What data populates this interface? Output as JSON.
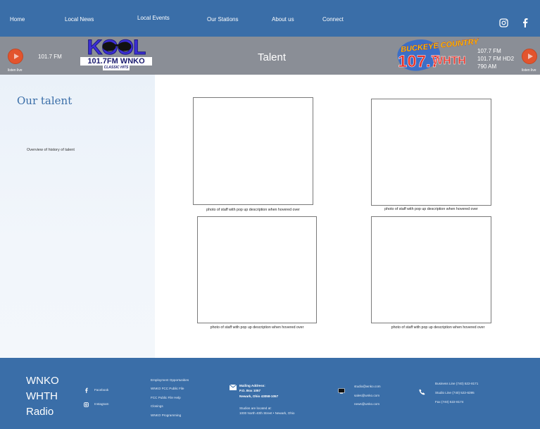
{
  "nav": {
    "links": [
      "Home",
      "Local News",
      "Local Events",
      "Our Stations",
      "About us",
      "Connect"
    ]
  },
  "banner": {
    "left_listen": "listen live",
    "left_freq": "101.7 FM",
    "title": "Talent",
    "right_freqs": [
      "107.7 FM",
      "101.7 FM HD2",
      "790 AM"
    ],
    "right_listen": "listen live",
    "kool_logo": {
      "word": "KOOL",
      "sub": "101.7FM  WNKO",
      "tag": "CLASSIC HITS"
    },
    "buckeye_logo": {
      "top": "BUCKEYE COUNTRY",
      "number": "107.7",
      "call": "WHTH"
    }
  },
  "sidebar": {
    "title": "Our talent",
    "text": "Overview of history of talent"
  },
  "photos": [
    "photo of staff with pop up description when hovered over",
    "photo of staff with pop up description when hovered over",
    "photo of staff with pop up description when hovered over",
    "photo of staff with pop up description when hovered over"
  ],
  "footer": {
    "brand": [
      "WNKO",
      "WHTH",
      "Radio"
    ],
    "social": {
      "facebook": "Facebook",
      "instagram": "Instagram"
    },
    "links": [
      "Employment Opportunities",
      "WNKO FCC Public File",
      "FCC Public File Help",
      "Closings",
      "WNKO Programming"
    ],
    "mailing": {
      "heading": "Mailing Address:",
      "line1": "P.O. Box 1057",
      "line2": "Newark, Ohio 43058-1057",
      "located_label": "Studios are located at:",
      "located": "1000 North 40th Street • Newark, Ohio"
    },
    "emails": [
      "studio@wnko.com",
      "sales@wnko.com",
      "news@wnko.com"
    ],
    "phones": [
      "Business Line (740) 522-8171",
      "Studio Line (740) 522-6395",
      "Fax (740) 522-8174"
    ]
  },
  "colors": {
    "primary": "#3a6ea8",
    "banner": "#8a8e96",
    "play": "#e3542d",
    "sidebar": "#eaf1f9"
  },
  "icons": [
    "instagram-icon",
    "facebook-icon",
    "play-icon",
    "envelope-icon",
    "email-icon",
    "phone-icon"
  ]
}
